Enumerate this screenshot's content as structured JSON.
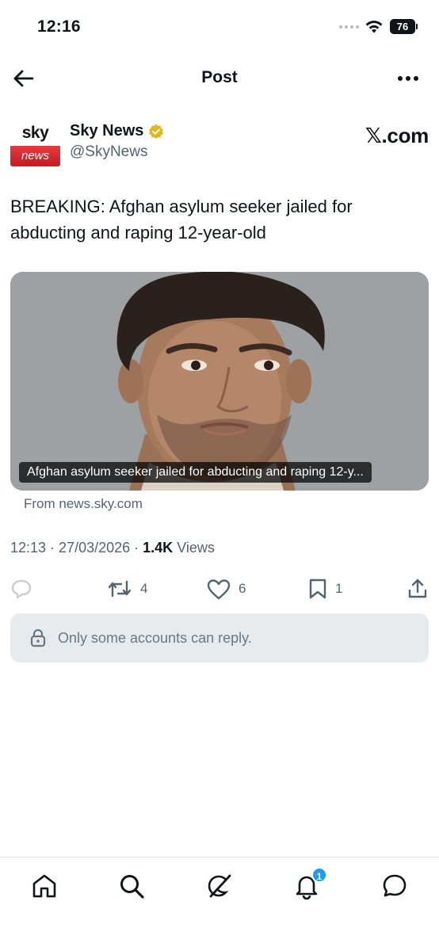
{
  "status_bar": {
    "time": "12:16",
    "battery": "76",
    "icons": [
      "signal-dots-icon",
      "wifi-icon",
      "battery-icon"
    ]
  },
  "header": {
    "title": "Post",
    "back_icon": "arrow-left-icon",
    "more_icon": "more-horizontal-icon"
  },
  "author": {
    "avatar_top": "sky",
    "avatar_bottom": "news",
    "name": "Sky News",
    "handle": "@SkyNews",
    "verified_icon": "gold-verified-badge-icon",
    "source_label": "𝕏.com"
  },
  "tweet": {
    "text": "BREAKING: Afghan asylum seeker jailed for abducting and raping 12-year-old"
  },
  "card": {
    "caption": "Afghan asylum seeker jailed for abducting and raping 12-y...",
    "source": "From news.sky.com"
  },
  "meta": {
    "time": "12:13",
    "date": "27/03/2026",
    "views_count": "1.4K",
    "views_label": "Views"
  },
  "actions": {
    "reply_icon": "reply-icon",
    "repost_count": "4",
    "like_count": "6",
    "bookmark_count": "1",
    "share_icon": "share-icon"
  },
  "reply_restriction": {
    "text": "Only some accounts can reply.",
    "icon": "lock-icon"
  },
  "bottom_nav": {
    "items": [
      "home-icon",
      "search-icon",
      "grok-icon",
      "notifications-icon",
      "messages-icon"
    ],
    "notification_badge": "1"
  },
  "colors": {
    "accent": "#1d9bf0",
    "secondary_text": "#536471",
    "verified_gold": "#e2b719",
    "sky_red": "#d9252c"
  }
}
